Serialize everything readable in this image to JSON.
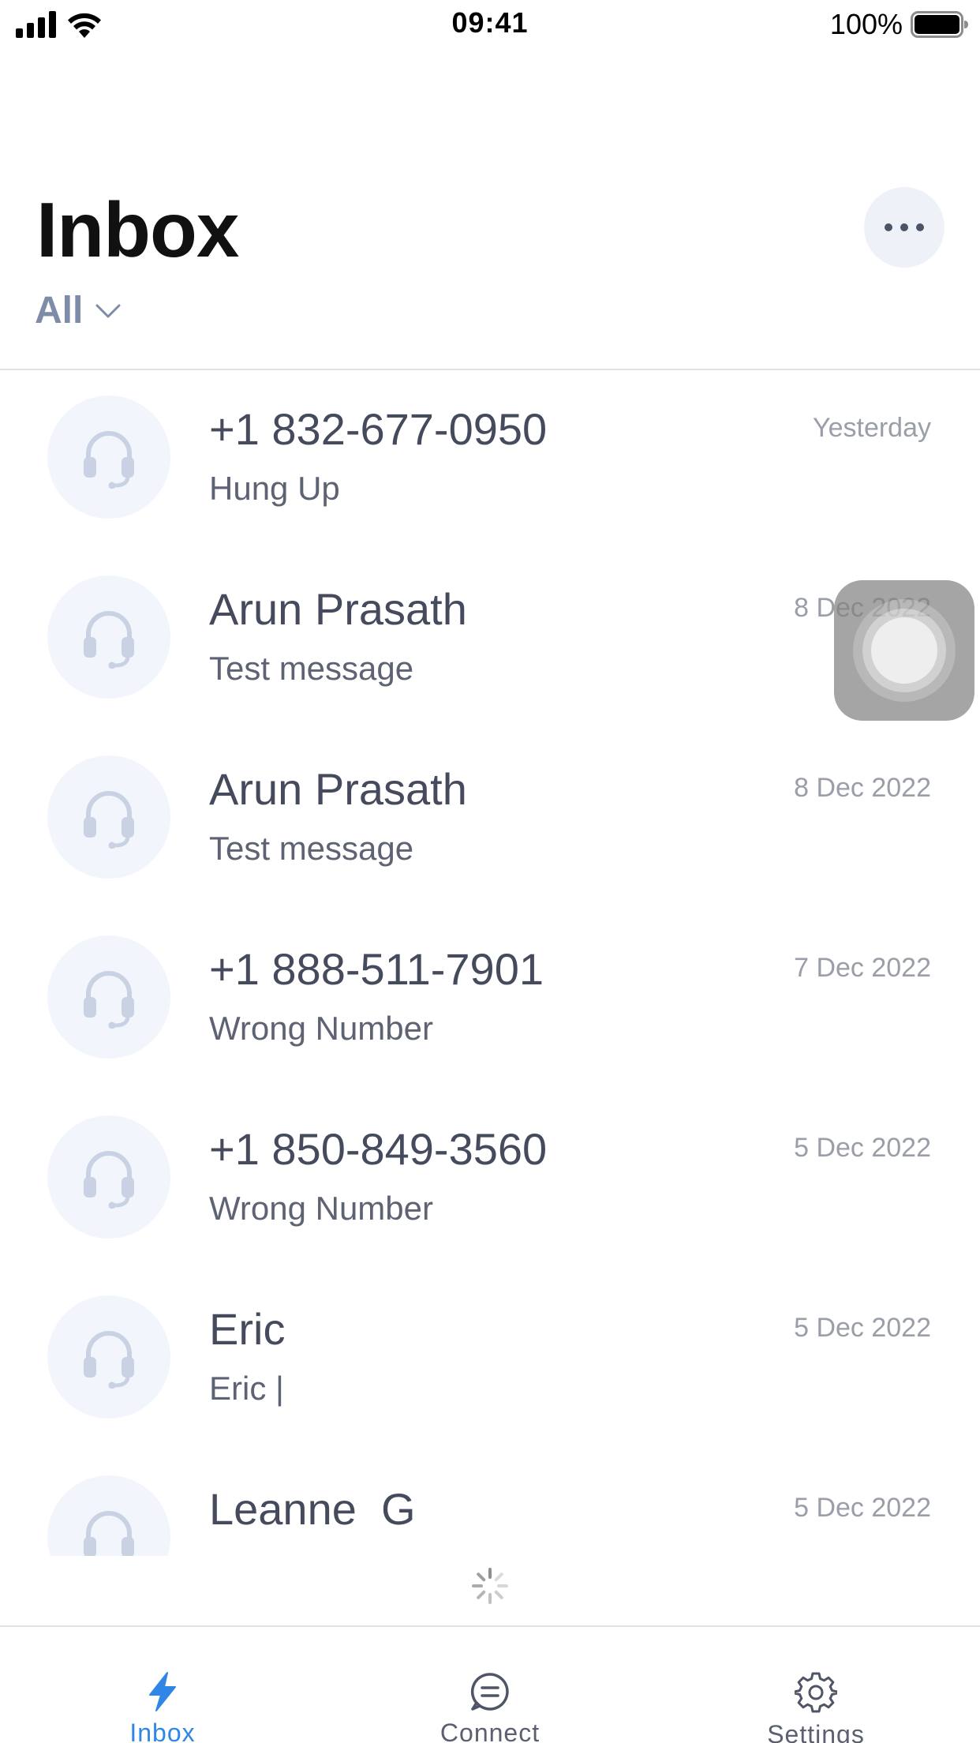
{
  "status_bar": {
    "time": "09:41",
    "battery": "100%"
  },
  "header": {
    "title": "Inbox",
    "filter": "All"
  },
  "conversations": [
    {
      "name": "+1 832-677-0950",
      "preview": "Hung Up",
      "date": "Yesterday"
    },
    {
      "name": "Arun Prasath",
      "preview": "Test message",
      "date": "8 Dec 2022"
    },
    {
      "name": "Arun Prasath",
      "preview": "Test message",
      "date": "8 Dec 2022"
    },
    {
      "name": "+1 888-511-7901",
      "preview": "Wrong Number",
      "date": "7 Dec 2022"
    },
    {
      "name": "+1 850-849-3560",
      "preview": "Wrong Number",
      "date": "5 Dec 2022"
    },
    {
      "name": "Eric",
      "preview": "Eric |",
      "date": "5 Dec 2022"
    },
    {
      "name": "Leanne  G",
      "preview": "",
      "date": "5 Dec 2022"
    }
  ],
  "tabs": [
    {
      "label": "Inbox",
      "icon": "lightning-icon",
      "active": true
    },
    {
      "label": "Connect",
      "icon": "chat-bubble-icon",
      "active": false
    },
    {
      "label": "Settings",
      "icon": "gear-icon",
      "active": false
    }
  ],
  "colors": {
    "accent": "#2f86e6",
    "title": "#111111",
    "filter": "#7f8ca8",
    "avatar_bg": "#f2f5fb",
    "avatar_icon": "#c9d2e3"
  }
}
